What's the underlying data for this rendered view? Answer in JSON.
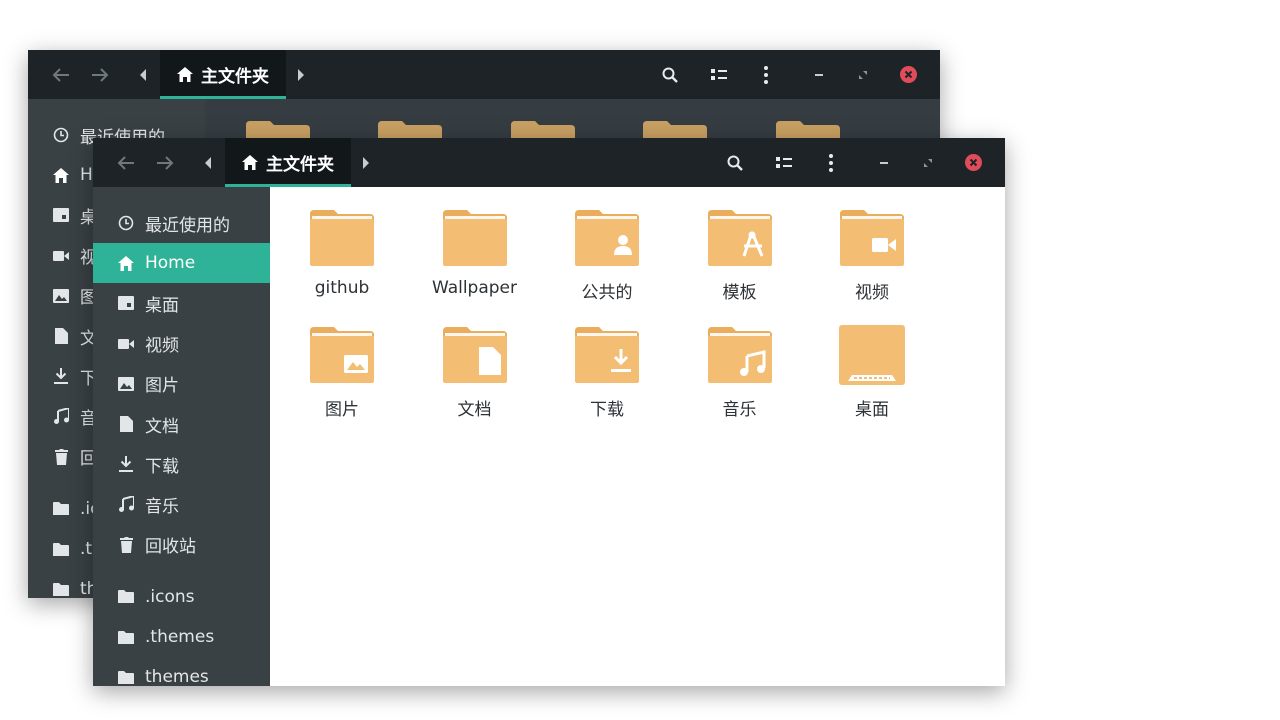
{
  "back_window": {
    "path_tab_label": "主文件夹",
    "sidebar_items": [
      {
        "icon": "clock-icon",
        "label": "最近使用的"
      },
      {
        "icon": "home-icon",
        "label": "H"
      },
      {
        "icon": "desktop-icon",
        "label": "桌"
      },
      {
        "icon": "video-icon",
        "label": "视"
      },
      {
        "icon": "image-icon",
        "label": "图"
      },
      {
        "icon": "document-icon",
        "label": "文"
      },
      {
        "icon": "download-icon",
        "label": "下"
      },
      {
        "icon": "music-icon",
        "label": "音"
      },
      {
        "icon": "trash-icon",
        "label": "回"
      },
      {
        "icon": "folder-icon",
        "label": ".ic"
      },
      {
        "icon": "folder-icon",
        "label": ".th"
      },
      {
        "icon": "folder-icon",
        "label": "th"
      }
    ]
  },
  "front_window": {
    "path_tab_label": "主文件夹",
    "sidebar_items": [
      {
        "icon": "clock-icon",
        "label": "最近使用的",
        "active": false
      },
      {
        "icon": "home-icon",
        "label": "Home",
        "active": true
      },
      {
        "icon": "desktop-icon",
        "label": "桌面",
        "active": false
      },
      {
        "icon": "video-icon",
        "label": "视频",
        "active": false
      },
      {
        "icon": "image-icon",
        "label": "图片",
        "active": false
      },
      {
        "icon": "document-icon",
        "label": "文档",
        "active": false
      },
      {
        "icon": "download-icon",
        "label": "下载",
        "active": false
      },
      {
        "icon": "music-icon",
        "label": "音乐",
        "active": false
      },
      {
        "icon": "trash-icon",
        "label": "回收站",
        "active": false
      },
      {
        "icon": "folder-icon",
        "label": ".icons",
        "active": false
      },
      {
        "icon": "folder-icon",
        "label": ".themes",
        "active": false
      },
      {
        "icon": "folder-icon",
        "label": "themes",
        "active": false
      }
    ],
    "files": [
      {
        "name": "github",
        "emblem": "none"
      },
      {
        "name": "Wallpaper",
        "emblem": "none"
      },
      {
        "name": "公共的",
        "emblem": "person"
      },
      {
        "name": "模板",
        "emblem": "template"
      },
      {
        "name": "视频",
        "emblem": "video"
      },
      {
        "name": "图片",
        "emblem": "image"
      },
      {
        "name": "文档",
        "emblem": "document"
      },
      {
        "name": "下载",
        "emblem": "download"
      },
      {
        "name": "音乐",
        "emblem": "music"
      },
      {
        "name": "桌面",
        "emblem": "desktop"
      }
    ]
  },
  "colors": {
    "accent": "#2eb398",
    "headerbar": "#1d2326",
    "sidebar": "#394145",
    "folder": "#f3be73",
    "close": "#e04c59"
  }
}
